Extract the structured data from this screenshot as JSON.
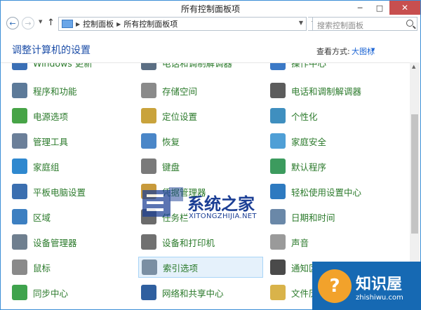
{
  "window": {
    "title": "所有控制面板项",
    "minimize": "─",
    "maximize": "□",
    "close": "✕"
  },
  "address": {
    "back": "←",
    "forward": "→",
    "up": "↑",
    "crumbs": [
      "控制面板",
      "所有控制面板项"
    ],
    "refresh": "↻",
    "search_placeholder": "搜索控制面板"
  },
  "header": {
    "title": "调整计算机的设置",
    "view_by_label": "查看方式:",
    "view_by_value": "大图标"
  },
  "items": [
    {
      "label": "Windows 更新",
      "color": "#3a6fb5"
    },
    {
      "label": "电话和调制解调器",
      "color": "#5b6e83"
    },
    {
      "label": "操作中心",
      "color": "#3b79c6"
    },
    {
      "label": "程序和功能",
      "color": "#5d7a99"
    },
    {
      "label": "存储空间",
      "color": "#8a8a8a"
    },
    {
      "label": "电话和调制解调器",
      "color": "#5c5c5c"
    },
    {
      "label": "电源选项",
      "color": "#47a447"
    },
    {
      "label": "定位设置",
      "color": "#c9a33c"
    },
    {
      "label": "个性化",
      "color": "#3f8fbf"
    },
    {
      "label": "管理工具",
      "color": "#6b7f99"
    },
    {
      "label": "恢复",
      "color": "#4a86c8"
    },
    {
      "label": "家庭安全",
      "color": "#4f9fd6"
    },
    {
      "label": "家庭组",
      "color": "#2f88cf"
    },
    {
      "label": "键盘",
      "color": "#7a7a7a"
    },
    {
      "label": "默认程序",
      "color": "#3c9b5e"
    },
    {
      "label": "平板电脑设置",
      "color": "#3b6fb0"
    },
    {
      "label": "凭据管理器",
      "color": "#c89a3b"
    },
    {
      "label": "轻松使用设置中心",
      "color": "#2e7ac0"
    },
    {
      "label": "区域",
      "color": "#3c7fc1"
    },
    {
      "label": "任务栏",
      "color": "#6b6b6b"
    },
    {
      "label": "日期和时间",
      "color": "#6a88a8"
    },
    {
      "label": "设备管理器",
      "color": "#6f7f8f"
    },
    {
      "label": "设备和打印机",
      "color": "#707070"
    },
    {
      "label": "声音",
      "color": "#9a9a9a"
    },
    {
      "label": "鼠标",
      "color": "#8a8a8a"
    },
    {
      "label": "索引选项",
      "color": "#7a8fa3"
    },
    {
      "label": "通知区域图标",
      "color": "#4a4a4a"
    },
    {
      "label": "同步中心",
      "color": "#3fa34d"
    },
    {
      "label": "网络和共享中心",
      "color": "#2f5f9f"
    },
    {
      "label": "文件历史记录",
      "color": "#d9b34a"
    }
  ],
  "watermark": {
    "site_name": "系统之家",
    "site_pinyin": "XITONGZHIJIA.NET",
    "brand2_icon": "?",
    "brand2_name": "知识屋",
    "brand2_url": "zhishiwu.com"
  }
}
